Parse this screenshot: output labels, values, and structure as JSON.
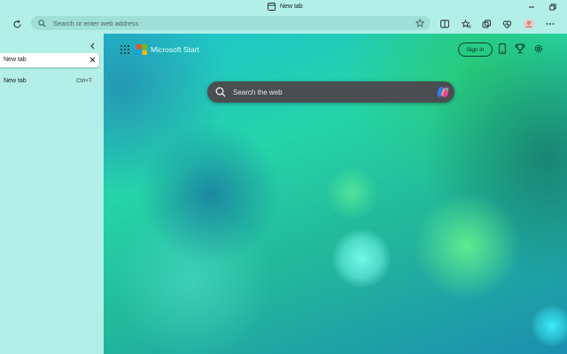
{
  "window": {
    "title": "New tab"
  },
  "address_bar": {
    "placeholder": "Search or enter web address"
  },
  "sidebar": {
    "active_tab": {
      "label": "New tab"
    },
    "items": [
      {
        "label": "New tab",
        "shortcut": "Ctrl+T"
      }
    ]
  },
  "newtab": {
    "brand": "Microsoft Start",
    "sign_in_label": "Sign in",
    "search_placeholder": "Search the web"
  },
  "colors": {
    "chrome_bg": "#b2efe9",
    "address_bg": "#9edfd7",
    "search_bg": "#4a4e50"
  },
  "icons": [
    "tab-page-icon",
    "minimize-icon",
    "restore-icon",
    "refresh-icon",
    "search-icon",
    "favorite-star-icon",
    "split-screen-icon",
    "favorites-icon",
    "collections-icon",
    "browser-essentials-icon",
    "profile-avatar",
    "more-icon",
    "collapse-sidebar-icon",
    "close-icon",
    "apps-grid-icon",
    "microsoft-logo",
    "phone-icon",
    "rewards-trophy-icon",
    "settings-gear-icon",
    "copilot-icon"
  ]
}
